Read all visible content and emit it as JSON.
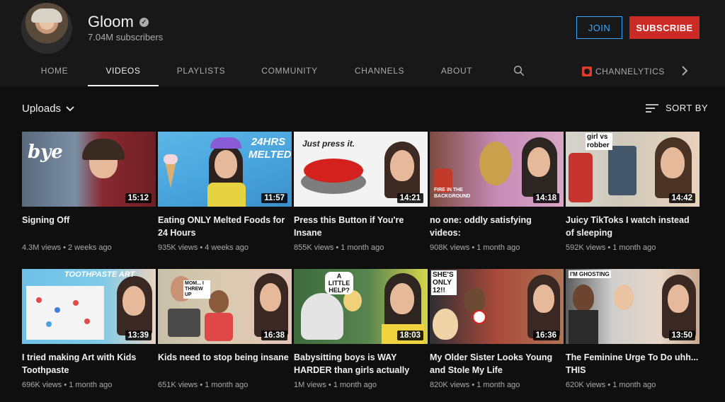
{
  "channel": {
    "name": "Gloom",
    "subscribers": "7.04M subscribers"
  },
  "buttons": {
    "join": "JOIN",
    "subscribe": "SUBSCRIBE"
  },
  "tabs": [
    "HOME",
    "VIDEOS",
    "PLAYLISTS",
    "COMMUNITY",
    "CHANNELS",
    "ABOUT"
  ],
  "active_tab": "VIDEOS",
  "extension": {
    "label": "CHANNELYTICS"
  },
  "filter": {
    "label": "Uploads"
  },
  "sort": {
    "label": "SORT BY"
  },
  "videos": [
    {
      "title": "Signing Off",
      "views": "4.3M views",
      "age": "2 weeks ago",
      "duration": "15:12",
      "overlay": "bye"
    },
    {
      "title": "Eating ONLY Melted Foods for 24 Hours",
      "views": "935K views",
      "age": "4 weeks ago",
      "duration": "11:57",
      "overlay": "24HRS MELTED"
    },
    {
      "title": "Press this Button if You're Insane",
      "views": "855K views",
      "age": "1 month ago",
      "duration": "14:21",
      "overlay": "Just press it."
    },
    {
      "title": "no one: oddly satisfying videos:",
      "views": "908K views",
      "age": "1 month ago",
      "duration": "14:18",
      "overlay": "FIRE IN THE BACKGROUND"
    },
    {
      "title": "Juicy TikToks I watch instead of sleeping",
      "views": "592K views",
      "age": "1 month ago",
      "duration": "14:42",
      "overlay": "girl vs robber"
    },
    {
      "title": "I tried making Art with Kids Toothpaste",
      "views": "696K views",
      "age": "1 month ago",
      "duration": "13:39",
      "overlay": "TOOTHPASTE ART"
    },
    {
      "title": "Kids need to stop being insane",
      "views": "651K views",
      "age": "1 month ago",
      "duration": "16:38",
      "overlay": "MOM... I THREW UP"
    },
    {
      "title": "Babysitting boys is WAY HARDER than girls actually",
      "views": "1M views",
      "age": "1 month ago",
      "duration": "18:03",
      "overlay": "A LITTLE HELP?"
    },
    {
      "title": "My Older Sister Looks Young and Stole My Life",
      "views": "820K views",
      "age": "1 month ago",
      "duration": "16:36",
      "overlay": "SHE'S ONLY 12!!"
    },
    {
      "title": "The Feminine Urge To Do uhh... THIS",
      "views": "620K views",
      "age": "1 month ago",
      "duration": "13:50",
      "overlay": "I'M GHOSTING"
    }
  ],
  "colors": {
    "background": "#0f0f0f",
    "header": "#181818",
    "subscribe": "#cc2a24",
    "join": "#3ea6ff",
    "secondary_text": "#aaaaaa"
  },
  "icons": [
    "verified-badge-icon",
    "search-icon",
    "channelytics-icon",
    "chevron-right-icon",
    "chevron-down-icon",
    "sort-icon"
  ]
}
